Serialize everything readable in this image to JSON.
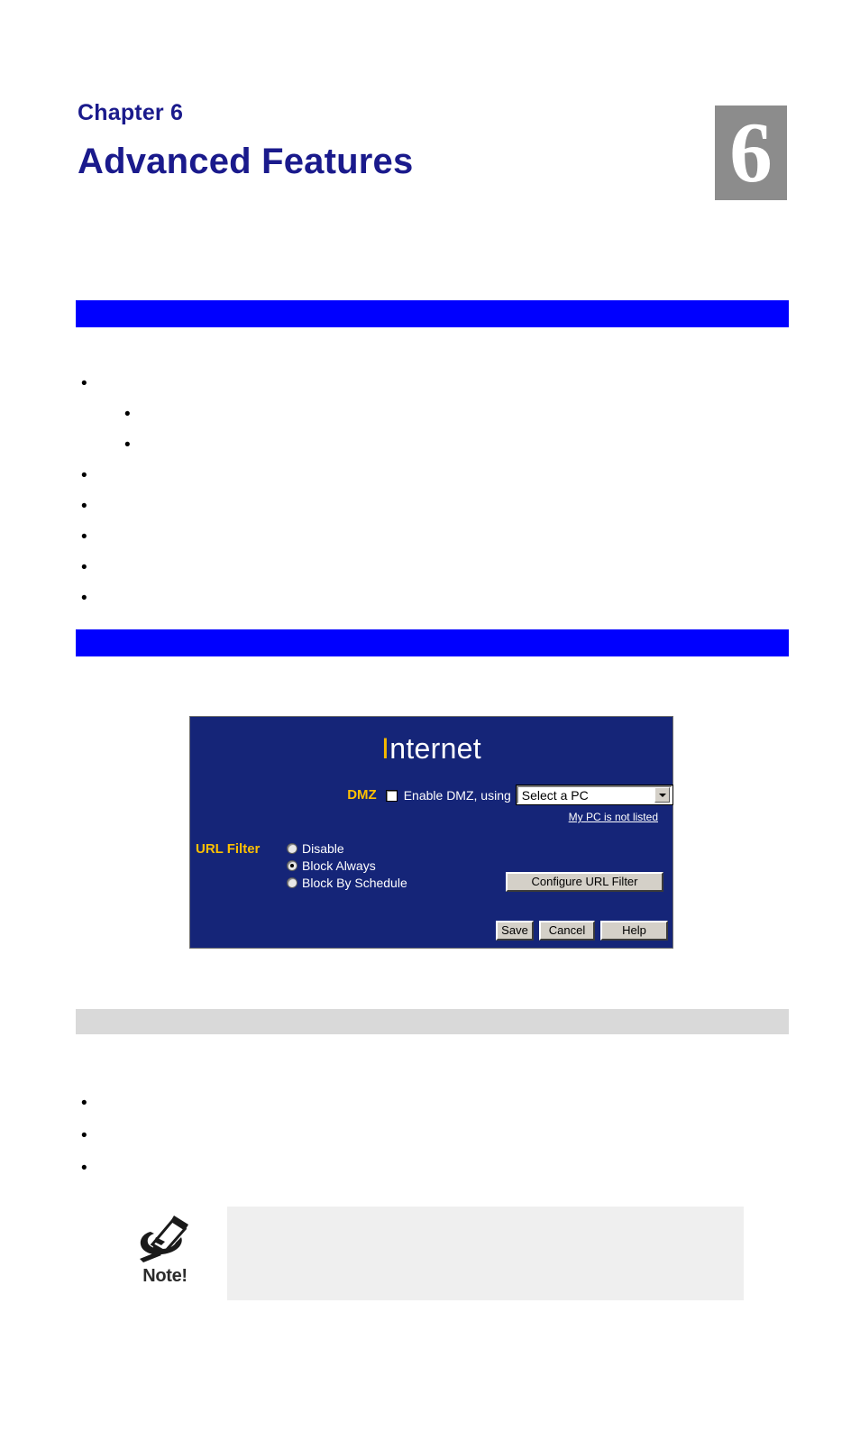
{
  "chapter": {
    "label": "Chapter 6",
    "title": "Advanced Features",
    "badge_number": "6",
    "badge_bg": "#8c8c8c",
    "heading_color": "#1a1a8c"
  },
  "sections": {
    "overview_bar": "",
    "internet_bar": "",
    "dmz_bar": "",
    "bar_color": "#0000ff",
    "gray_bar_color": "#d9d9d9"
  },
  "overview_list": [
    {
      "level": 1,
      "text": ""
    },
    {
      "level": 2,
      "text": ""
    },
    {
      "level": 2,
      "text": ""
    },
    {
      "level": 1,
      "text": ""
    },
    {
      "level": 1,
      "text": ""
    },
    {
      "level": 1,
      "text": ""
    },
    {
      "level": 1,
      "text": ""
    },
    {
      "level": 1,
      "text": ""
    }
  ],
  "internet_list": [
    {
      "level": 1,
      "text": ""
    },
    {
      "level": 1,
      "text": ""
    },
    {
      "level": 1,
      "text": ""
    }
  ],
  "router_ui": {
    "panel_bg": "#152578",
    "title_accent_letter": "I",
    "title_rest": "nternet",
    "accent_color": "#f5b800",
    "label_color": "#ffc000",
    "dmz": {
      "field_label": "DMZ",
      "checkbox_label": "Enable DMZ, using",
      "checkbox_checked": false,
      "select_value": "Select a PC",
      "select_options": [
        "Select a PC"
      ],
      "helper_link": "My PC is not listed"
    },
    "url_filter": {
      "field_label": "URL Filter",
      "selected": "Block Always",
      "options": [
        {
          "label": "Disable",
          "checked": false
        },
        {
          "label": "Block Always",
          "checked": true
        },
        {
          "label": "Block By Schedule",
          "checked": false
        }
      ],
      "configure_button": "Configure URL Filter"
    },
    "buttons": {
      "save": "Save",
      "cancel": "Cancel",
      "help": "Help"
    }
  },
  "note": {
    "word": "Note!",
    "body": ""
  }
}
